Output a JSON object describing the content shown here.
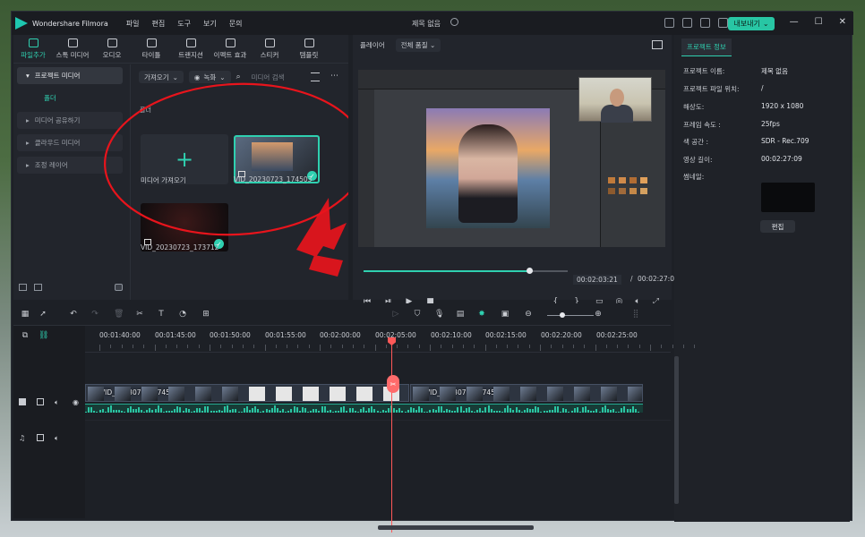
{
  "app": {
    "name": "Wondershare Filmora",
    "project_title": "제목 없음",
    "export_label": "내보내기"
  },
  "menu": [
    "파일",
    "편집",
    "도구",
    "보기",
    "문의"
  ],
  "library": {
    "tabs": [
      {
        "label": "파일추가",
        "icon": "media-icon"
      },
      {
        "label": "스톡 미디어",
        "icon": "stock-media-icon"
      },
      {
        "label": "오디오",
        "icon": "music-note-icon"
      },
      {
        "label": "타이틀",
        "icon": "title-T-icon"
      },
      {
        "label": "트랜지션",
        "icon": "transition-icon"
      },
      {
        "label": "이펙트 효과",
        "icon": "effects-icon"
      },
      {
        "label": "스티커",
        "icon": "sticker-icon"
      },
      {
        "label": "템플릿",
        "icon": "template-icon"
      }
    ],
    "sidebar": {
      "project_media": "프로젝트 미디어",
      "folder": "폴더",
      "items": [
        "미디어 공유하기",
        "클라우드 미디어",
        "조정 레이어"
      ]
    },
    "import_dropdown": "가져오기",
    "record_dropdown": "녹화",
    "search_placeholder": "미디어 검색",
    "folder_label": "폴더",
    "media": [
      {
        "label": "미디어 가져오기"
      },
      {
        "label": "VID_20230723_174503"
      },
      {
        "label": "VID_20230723_173712"
      }
    ]
  },
  "preview": {
    "player_label": "플레이어",
    "quality": "전체 품질",
    "progress": 0.81,
    "current_time": "00:02:03:21",
    "total_time": "00:02:27:09"
  },
  "info": {
    "tab": "프로젝트 정보",
    "rows": [
      {
        "label": "프로젝트 이름:",
        "value": "제목 없음"
      },
      {
        "label": "프로젝트 파일 위치:",
        "value": "/"
      },
      {
        "label": "해상도:",
        "value": "1920 x 1080"
      },
      {
        "label": "프레임 속도 :",
        "value": "25fps"
      },
      {
        "label": "색 공간 :",
        "value": "SDR - Rec.709"
      },
      {
        "label": "영상 길이:",
        "value": "00:02:27:09"
      },
      {
        "label": "썸네일:",
        "value": ""
      }
    ],
    "edit_label": "편집"
  },
  "timeline": {
    "ticks": [
      "00:01:40:00",
      "00:01:45:00",
      "00:01:50:00",
      "00:01:55:00",
      "00:02:00:00",
      "00:02:05:00",
      "00:02:10:00",
      "00:02:15:00",
      "00:02:20:00",
      "00:02:25:00"
    ],
    "clip_a": "VID_20230723_174503",
    "clip_b": "VID_20230723_174503"
  },
  "colors": {
    "accent": "#2fd0b0",
    "playhead": "#ff5858",
    "annotation": "#e8141c"
  }
}
